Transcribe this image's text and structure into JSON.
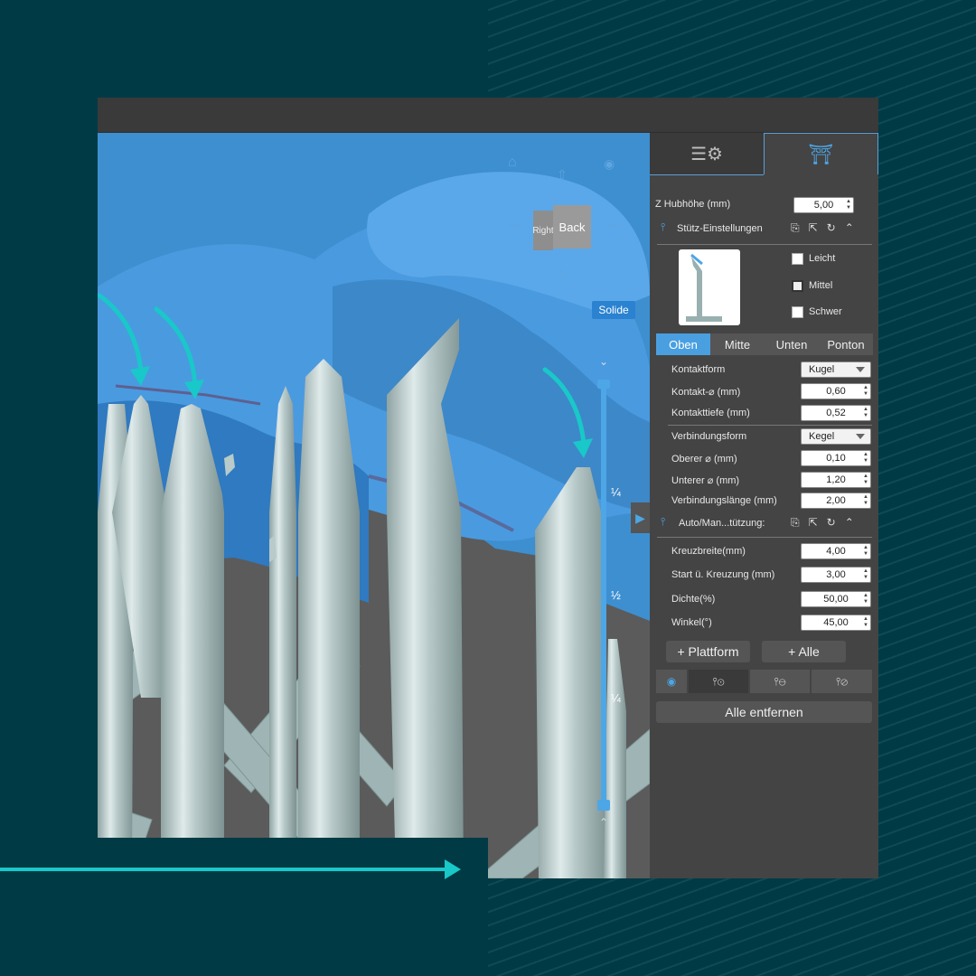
{
  "viewcube": {
    "face_right": "Right",
    "face_back": "Back"
  },
  "render_mode": "Solide",
  "slider_ticks": [
    "¼",
    "½",
    "¼"
  ],
  "panel": {
    "z_lift_label": "Z Hubhöhe (mm)",
    "z_lift_value": "5,00",
    "support_settings_title": "Stütz-Einstellungen",
    "density_options": [
      {
        "label": "Leicht",
        "checked": false
      },
      {
        "label": "Mittel",
        "checked": true
      },
      {
        "label": "Schwer",
        "checked": false
      }
    ],
    "segments": [
      "Oben",
      "Mitte",
      "Unten",
      "Ponton"
    ],
    "active_segment": "Oben",
    "top": {
      "contact_shape_label": "Kontaktform",
      "contact_shape_value": "Kugel",
      "contact_diameter_label": "Kontakt-⌀ (mm)",
      "contact_diameter_value": "0,60",
      "contact_depth_label": "Kontakttiefe (mm)",
      "contact_depth_value": "0,52",
      "connection_shape_label": "Verbindungsform",
      "connection_shape_value": "Kegel",
      "upper_diameter_label": "Oberer ⌀ (mm)",
      "upper_diameter_value": "0,10",
      "lower_diameter_label": "Unterer ⌀ (mm)",
      "lower_diameter_value": "1,20",
      "connection_length_label": "Verbindungslänge (mm)",
      "connection_length_value": "2,00"
    },
    "auto_title": "Auto/Man...tützung:",
    "auto": {
      "cross_width_label": "Kreuzbreite(mm)",
      "cross_width_value": "4,00",
      "cross_start_label": "Start ü. Kreuzung (mm)",
      "cross_start_value": "3,00",
      "density_label": "Dichte(%)",
      "density_value": "50,00",
      "angle_label": "Winkel(°)",
      "angle_value": "45,00"
    },
    "btn_platform": "+ Plattform",
    "btn_all": "+ Alle",
    "btn_remove_all": "Alle entfernen"
  },
  "colors": {
    "accent": "#4a9fe0",
    "teal_arrow": "#19c8c8",
    "model_blue": "#3d8fd0",
    "support_grey": "#a9bfbf"
  }
}
